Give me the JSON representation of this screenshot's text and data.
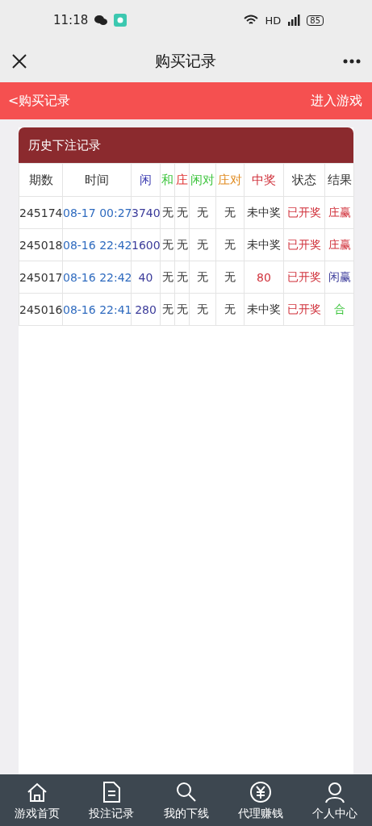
{
  "status_bar": {
    "time": "11:18",
    "network": "HD",
    "battery": "85"
  },
  "nav_bar": {
    "title": "购买记录"
  },
  "sub_header": {
    "back": "<购买记录",
    "action": "进入游戏"
  },
  "panel": {
    "title": "历史下注记录",
    "columns": [
      {
        "label": "期数",
        "color": "#333333"
      },
      {
        "label": "时间",
        "color": "#333333"
      },
      {
        "label": "闲",
        "color": "#3b3bb0"
      },
      {
        "label": "和",
        "color": "#3cc43c"
      },
      {
        "label": "庄",
        "color": "#e03030"
      },
      {
        "label": "闲对",
        "color": "#3cc43c"
      },
      {
        "label": "庄对",
        "color": "#e08a1e"
      },
      {
        "label": "中奖",
        "color": "#d0303a"
      },
      {
        "label": "状态",
        "color": "#333333"
      },
      {
        "label": "结果",
        "color": "#333333"
      }
    ],
    "rows": [
      {
        "cells": [
          {
            "text": "245174",
            "color": "#333333"
          },
          {
            "text": "08-17 00:27",
            "color": "#2f6bbf"
          },
          {
            "text": "3740",
            "color": "#3b3b9a"
          },
          {
            "text": "无",
            "color": "#333333"
          },
          {
            "text": "无",
            "color": "#333333"
          },
          {
            "text": "无",
            "color": "#333333"
          },
          {
            "text": "无",
            "color": "#333333"
          },
          {
            "text": "未中奖",
            "color": "#333333"
          },
          {
            "text": "已开奖",
            "color": "#d0303a"
          },
          {
            "text": "庄赢",
            "color": "#d0303a"
          }
        ]
      },
      {
        "cells": [
          {
            "text": "245018",
            "color": "#333333"
          },
          {
            "text": "08-16 22:42",
            "color": "#2f6bbf"
          },
          {
            "text": "1600",
            "color": "#3b3b9a"
          },
          {
            "text": "无",
            "color": "#333333"
          },
          {
            "text": "无",
            "color": "#333333"
          },
          {
            "text": "无",
            "color": "#333333"
          },
          {
            "text": "无",
            "color": "#333333"
          },
          {
            "text": "未中奖",
            "color": "#333333"
          },
          {
            "text": "已开奖",
            "color": "#d0303a"
          },
          {
            "text": "庄赢",
            "color": "#d0303a"
          }
        ]
      },
      {
        "cells": [
          {
            "text": "245017",
            "color": "#333333"
          },
          {
            "text": "08-16 22:42",
            "color": "#2f6bbf"
          },
          {
            "text": "40",
            "color": "#3b3b9a"
          },
          {
            "text": "无",
            "color": "#333333"
          },
          {
            "text": "无",
            "color": "#333333"
          },
          {
            "text": "无",
            "color": "#333333"
          },
          {
            "text": "无",
            "color": "#333333"
          },
          {
            "text": "80",
            "color": "#d0303a"
          },
          {
            "text": "已开奖",
            "color": "#d0303a"
          },
          {
            "text": "闲赢",
            "color": "#3b3b9a"
          }
        ]
      },
      {
        "cells": [
          {
            "text": "245016",
            "color": "#333333"
          },
          {
            "text": "08-16 22:41",
            "color": "#2f6bbf"
          },
          {
            "text": "280",
            "color": "#3b3b9a"
          },
          {
            "text": "无",
            "color": "#333333"
          },
          {
            "text": "无",
            "color": "#333333"
          },
          {
            "text": "无",
            "color": "#333333"
          },
          {
            "text": "无",
            "color": "#333333"
          },
          {
            "text": "未中奖",
            "color": "#333333"
          },
          {
            "text": "已开奖",
            "color": "#d0303a"
          },
          {
            "text": "合",
            "color": "#3cc43c"
          }
        ]
      }
    ]
  },
  "tab_bar": [
    {
      "kind": "home",
      "label": "游戏首页"
    },
    {
      "kind": "doc",
      "label": "投注记录"
    },
    {
      "kind": "search",
      "label": "我的下线"
    },
    {
      "kind": "yen",
      "label": "代理赚钱"
    },
    {
      "kind": "person",
      "label": "个人中心"
    }
  ]
}
